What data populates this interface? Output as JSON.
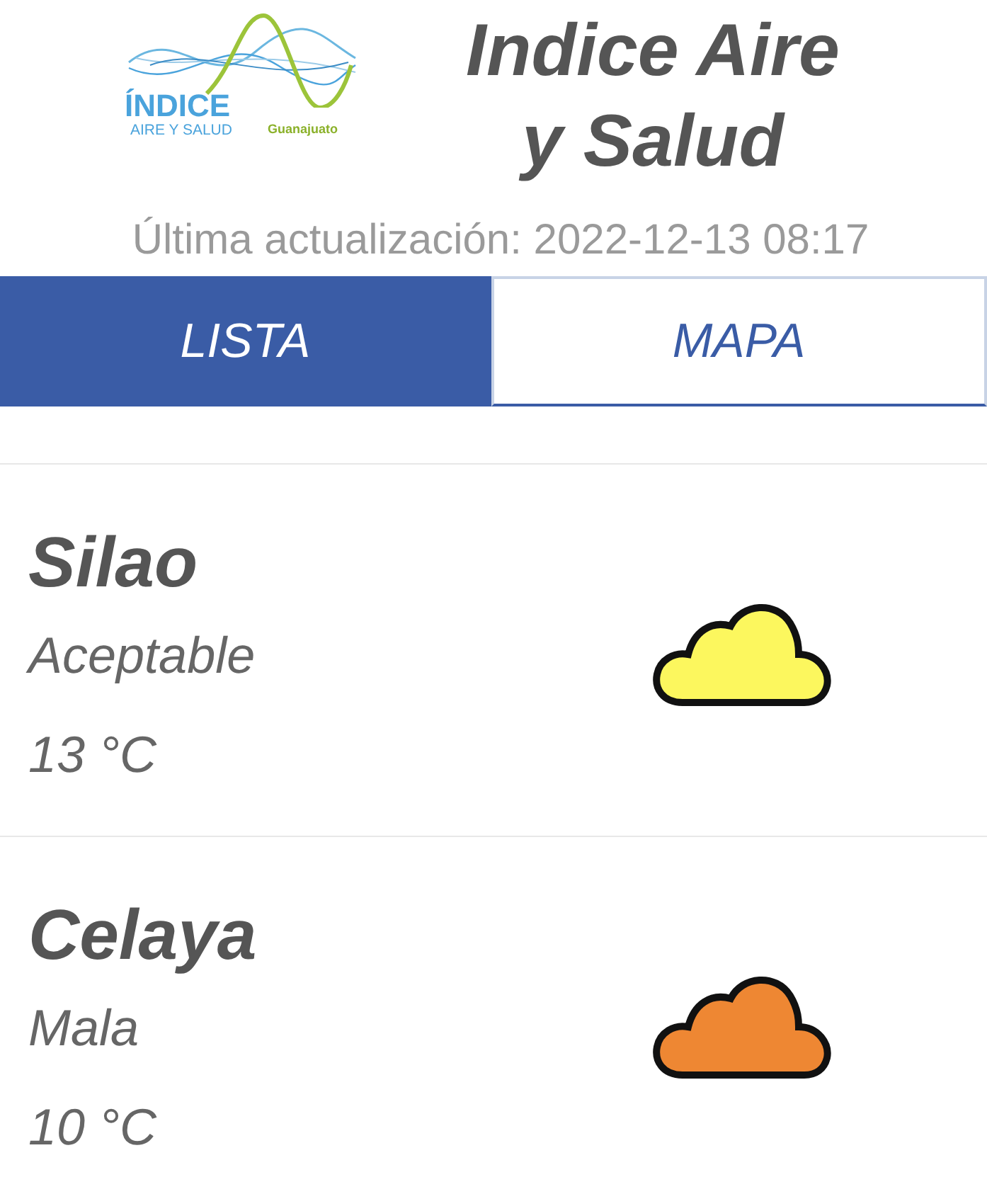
{
  "header": {
    "logo": {
      "title": "ÍNDICE",
      "subtitle": "AIRE Y SALUD",
      "region": "Guanajuato"
    },
    "title": "Indice Aire y Salud",
    "last_update": "Última actualización: 2022-12-13 08:17"
  },
  "tabs": [
    {
      "label": "LISTA",
      "selected": true
    },
    {
      "label": "MAPA",
      "selected": false
    }
  ],
  "stations": [
    {
      "name": "Silao",
      "quality": "Aceptable",
      "temperature": "13 °C",
      "color": "#fcf75e"
    },
    {
      "name": "Celaya",
      "quality": "Mala",
      "temperature": "10 °C",
      "color": "#ee8733"
    }
  ]
}
